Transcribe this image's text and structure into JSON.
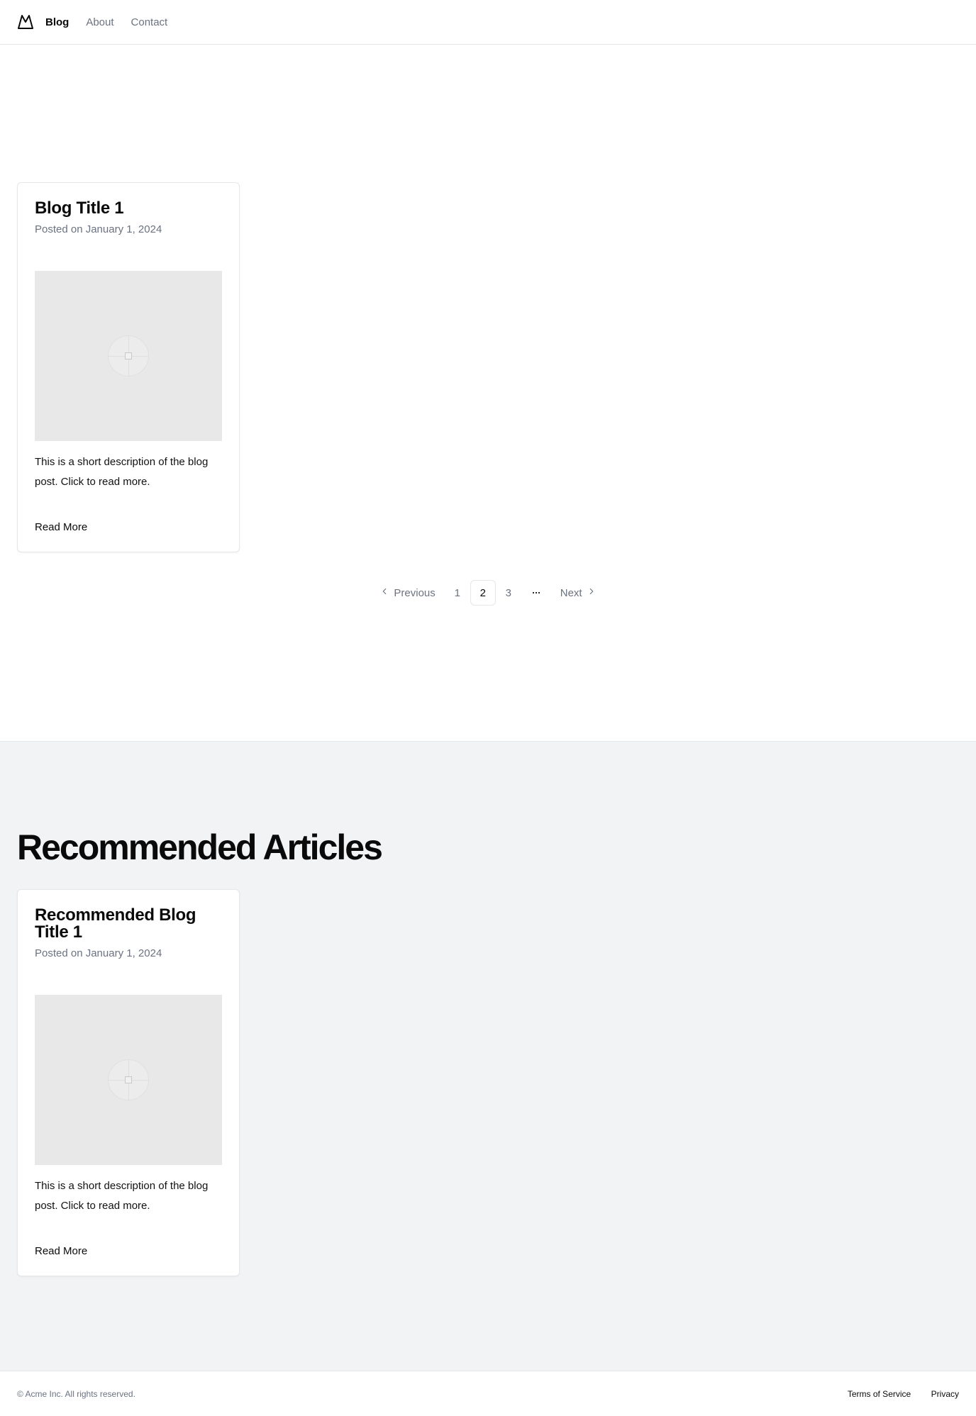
{
  "header": {
    "logo_icon": "mountain-logo-icon",
    "nav": [
      {
        "label": "Blog",
        "active": true
      },
      {
        "label": "About",
        "active": false
      },
      {
        "label": "Contact",
        "active": false
      }
    ]
  },
  "posts": [
    {
      "title": "Blog Title 1",
      "date": "Posted on January 1, 2024",
      "image_icon": "image-placeholder-icon",
      "description": "This is a short description of the blog post. Click to read more.",
      "link_label": "Read More"
    }
  ],
  "pagination": {
    "previous_label": "Previous",
    "next_label": "Next",
    "pages": [
      "1",
      "2",
      "3"
    ],
    "current_page": "2",
    "ellipsis_icon": "more-horizontal-icon"
  },
  "recommended": {
    "heading": "Recommended Articles",
    "posts": [
      {
        "title": "Recommended Blog Title 1",
        "date": "Posted on January 1, 2024",
        "image_icon": "image-placeholder-icon",
        "description": "This is a short description of the blog post. Click to read more.",
        "link_label": "Read More"
      }
    ]
  },
  "footer": {
    "copyright": "© Acme Inc. All rights reserved.",
    "links": [
      "Terms of Service",
      "Privacy"
    ]
  }
}
